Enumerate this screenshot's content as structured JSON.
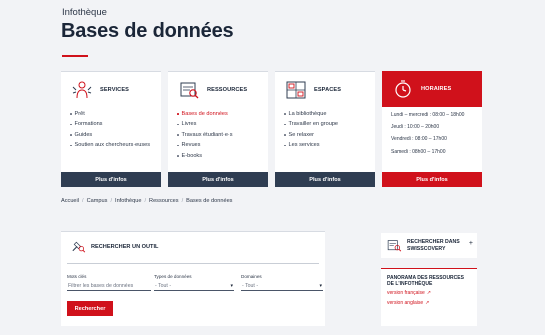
{
  "header": {
    "eyebrow": "Infothèque",
    "title": "Bases de données"
  },
  "cards": [
    {
      "title": "SERVICES",
      "icon": "services-icon",
      "items": [
        "Prêt",
        "Formations",
        "Guides",
        "Soutien aux chercheurs·euses"
      ],
      "more": "Plus d'infos"
    },
    {
      "title": "RESSOURCES",
      "icon": "resources-icon",
      "items": [
        "Bases de données",
        "Livres",
        "Travaux étudiant·e·s",
        "Revues",
        "E-books"
      ],
      "active_item": "Bases de données",
      "more": "Plus d'infos"
    },
    {
      "title": "ESPACES",
      "icon": "spaces-icon",
      "items": [
        "La bibliothèque",
        "Travailler en groupe",
        "Se relaxer",
        "Les services"
      ],
      "more": "Plus d'infos"
    },
    {
      "title": "HORAIRES",
      "icon": "clock-icon",
      "hours": [
        "Lundi – mercredi : 08:00 – 18h00",
        "Jeudi : 10:00 – 20h00",
        "Vendredi : 08:00 – 17h00",
        "Samedi : 08h00 – 17h00"
      ],
      "more": "Plus d'infos"
    }
  ],
  "breadcrumb": [
    "Accueil",
    "Campus",
    "Infothèque",
    "Ressources",
    "Bases de données"
  ],
  "breadcrumb_separator": "/",
  "search_panel": {
    "title": "RECHERCHER UN OUTIL",
    "fields": {
      "keywords_label": "Mots clés",
      "keywords_placeholder": "Filtrer les bases de données",
      "type_label": "Types de données",
      "type_value": "- Tout -",
      "domain_label": "Domaines",
      "domain_value": "- Tout -"
    },
    "submit": "Rechercher"
  },
  "swisscovery": {
    "line1": "RECHERCHER DANS",
    "line2": "SWISSCOVERY",
    "toggle": "+"
  },
  "panorama": {
    "title_line1": "PANORAMA DES RESSOURCES",
    "title_line2": "DE L'INFOTHÈQUE",
    "links": [
      "version française",
      "version anglaise"
    ]
  },
  "colors": {
    "accent": "#d0111b",
    "navy": "#2f3d52",
    "background": "#f2f3f6"
  }
}
